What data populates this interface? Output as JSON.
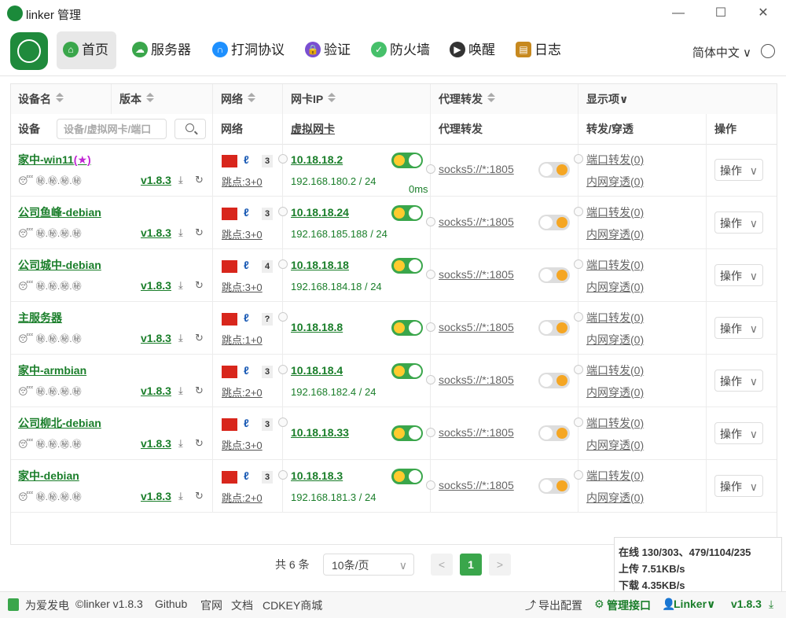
{
  "window": {
    "title": "linker 管理",
    "min": "—",
    "max": "☐",
    "close": "✕"
  },
  "nav": {
    "items": [
      {
        "label": "首页",
        "icon": "home-icon",
        "color": "#3aa64b"
      },
      {
        "label": "服务器",
        "icon": "server-icon",
        "color": "#3aa64b"
      },
      {
        "label": "打洞协议",
        "icon": "tunnel-icon",
        "color": "#1e90ff"
      },
      {
        "label": "验证",
        "icon": "lock-icon",
        "color": "#7a4fd1"
      },
      {
        "label": "防火墙",
        "icon": "shield-icon",
        "color": "#46c06a"
      },
      {
        "label": "唤醒",
        "icon": "play-icon",
        "color": "#333333"
      },
      {
        "label": "日志",
        "icon": "log-icon",
        "color": "#c7891f"
      }
    ],
    "language": "简体中文",
    "language_caret": "∨"
  },
  "table": {
    "headers": {
      "device": "设备名",
      "version": "版本",
      "network": "网络",
      "nic_ip": "网卡IP",
      "proxy": "代理转发",
      "display": "显示项"
    },
    "subheaders": {
      "device": "设备",
      "network": "网络",
      "vnic": "虚拟网卡",
      "proxy": "代理转发",
      "forward": "转发/穿透",
      "action": "操作"
    },
    "search_placeholder": "设备/虚拟网卡/端口",
    "rows": [
      {
        "name": "家中-win11",
        "star": "(★)",
        "sub": "😴 ㊙.㊙.㊙.㊙",
        "version": "v1.8.3",
        "isp_count": "3",
        "hops": "跳点:3+0",
        "vip": "10.18.18.2",
        "lan": "192.168.180.2 / 24",
        "latency": "0ms",
        "proxy": "socks5://*:1805",
        "port_forward": "端口转发(0)",
        "intranet": "内网穿透(0)",
        "action": "操作"
      },
      {
        "name": "公司鱼峰-debian",
        "star": "",
        "sub": "😴 ㊙.㊙.㊙.㊙",
        "version": "v1.8.3",
        "isp_count": "3",
        "hops": "跳点:3+0",
        "vip": "10.18.18.24",
        "lan": "192.168.185.188 / 24",
        "latency": "",
        "proxy": "socks5://*:1805",
        "port_forward": "端口转发(0)",
        "intranet": "内网穿透(0)",
        "action": "操作"
      },
      {
        "name": "公司城中-debian",
        "star": "",
        "sub": "😴 ㊙.㊙.㊙.㊙",
        "version": "v1.8.3",
        "isp_count": "4",
        "hops": "跳点:3+0",
        "vip": "10.18.18.18",
        "lan": "192.168.184.18 / 24",
        "latency": "",
        "proxy": "socks5://*:1805",
        "port_forward": "端口转发(0)",
        "intranet": "内网穿透(0)",
        "action": "操作"
      },
      {
        "name": "主服务器",
        "star": "",
        "sub": "😴 ㊙.㊙.㊙.㊙",
        "version": "v1.8.3",
        "isp_count": "?",
        "hops": "跳点:1+0",
        "vip": "10.18.18.8",
        "lan": "",
        "latency": "",
        "proxy": "socks5://*:1805",
        "port_forward": "端口转发(0)",
        "intranet": "内网穿透(0)",
        "action": "操作"
      },
      {
        "name": "家中-armbian",
        "star": "",
        "sub": "😴 ㊙.㊙.㊙.㊙",
        "version": "v1.8.3",
        "isp_count": "3",
        "hops": "跳点:2+0",
        "vip": "10.18.18.4",
        "lan": "192.168.182.4 / 24",
        "latency": "",
        "proxy": "socks5://*:1805",
        "port_forward": "端口转发(0)",
        "intranet": "内网穿透(0)",
        "action": "操作"
      },
      {
        "name": "公司柳北-debian",
        "star": "",
        "sub": "😴 ㊙.㊙.㊙.㊙",
        "version": "v1.8.3",
        "isp_count": "3",
        "hops": "跳点:3+0",
        "vip": "10.18.18.33",
        "lan": "",
        "latency": "",
        "proxy": "socks5://*:1805",
        "port_forward": "端口转发(0)",
        "intranet": "内网穿透(0)",
        "action": "操作"
      },
      {
        "name": "家中-debian",
        "star": "",
        "sub": "😴 ㊙.㊙.㊙.㊙",
        "version": "v1.8.3",
        "isp_count": "3",
        "hops": "跳点:2+0",
        "vip": "10.18.18.3",
        "lan": "192.168.181.3 / 24",
        "latency": "",
        "proxy": "socks5://*:1805",
        "port_forward": "端口转发(0)",
        "intranet": "内网穿透(0)",
        "action": "操作"
      }
    ]
  },
  "pager": {
    "total": "共 6 条",
    "page_size": "10条/页",
    "prev": "<",
    "current": "1",
    "next": ">"
  },
  "status": {
    "online": "在线 130/303、479/1104/235",
    "upload": "上传 7.51KB/s",
    "download": "下载 4.35KB/s"
  },
  "footer": {
    "power": "为爱发电",
    "copyright": "©linker v1.8.3",
    "github": "Github",
    "site": "官网",
    "docs": "文档",
    "shop": "CDKEY商城",
    "export": "导出配置",
    "api": "管理接口",
    "user": "Linker∨",
    "version": "v1.8.3"
  }
}
